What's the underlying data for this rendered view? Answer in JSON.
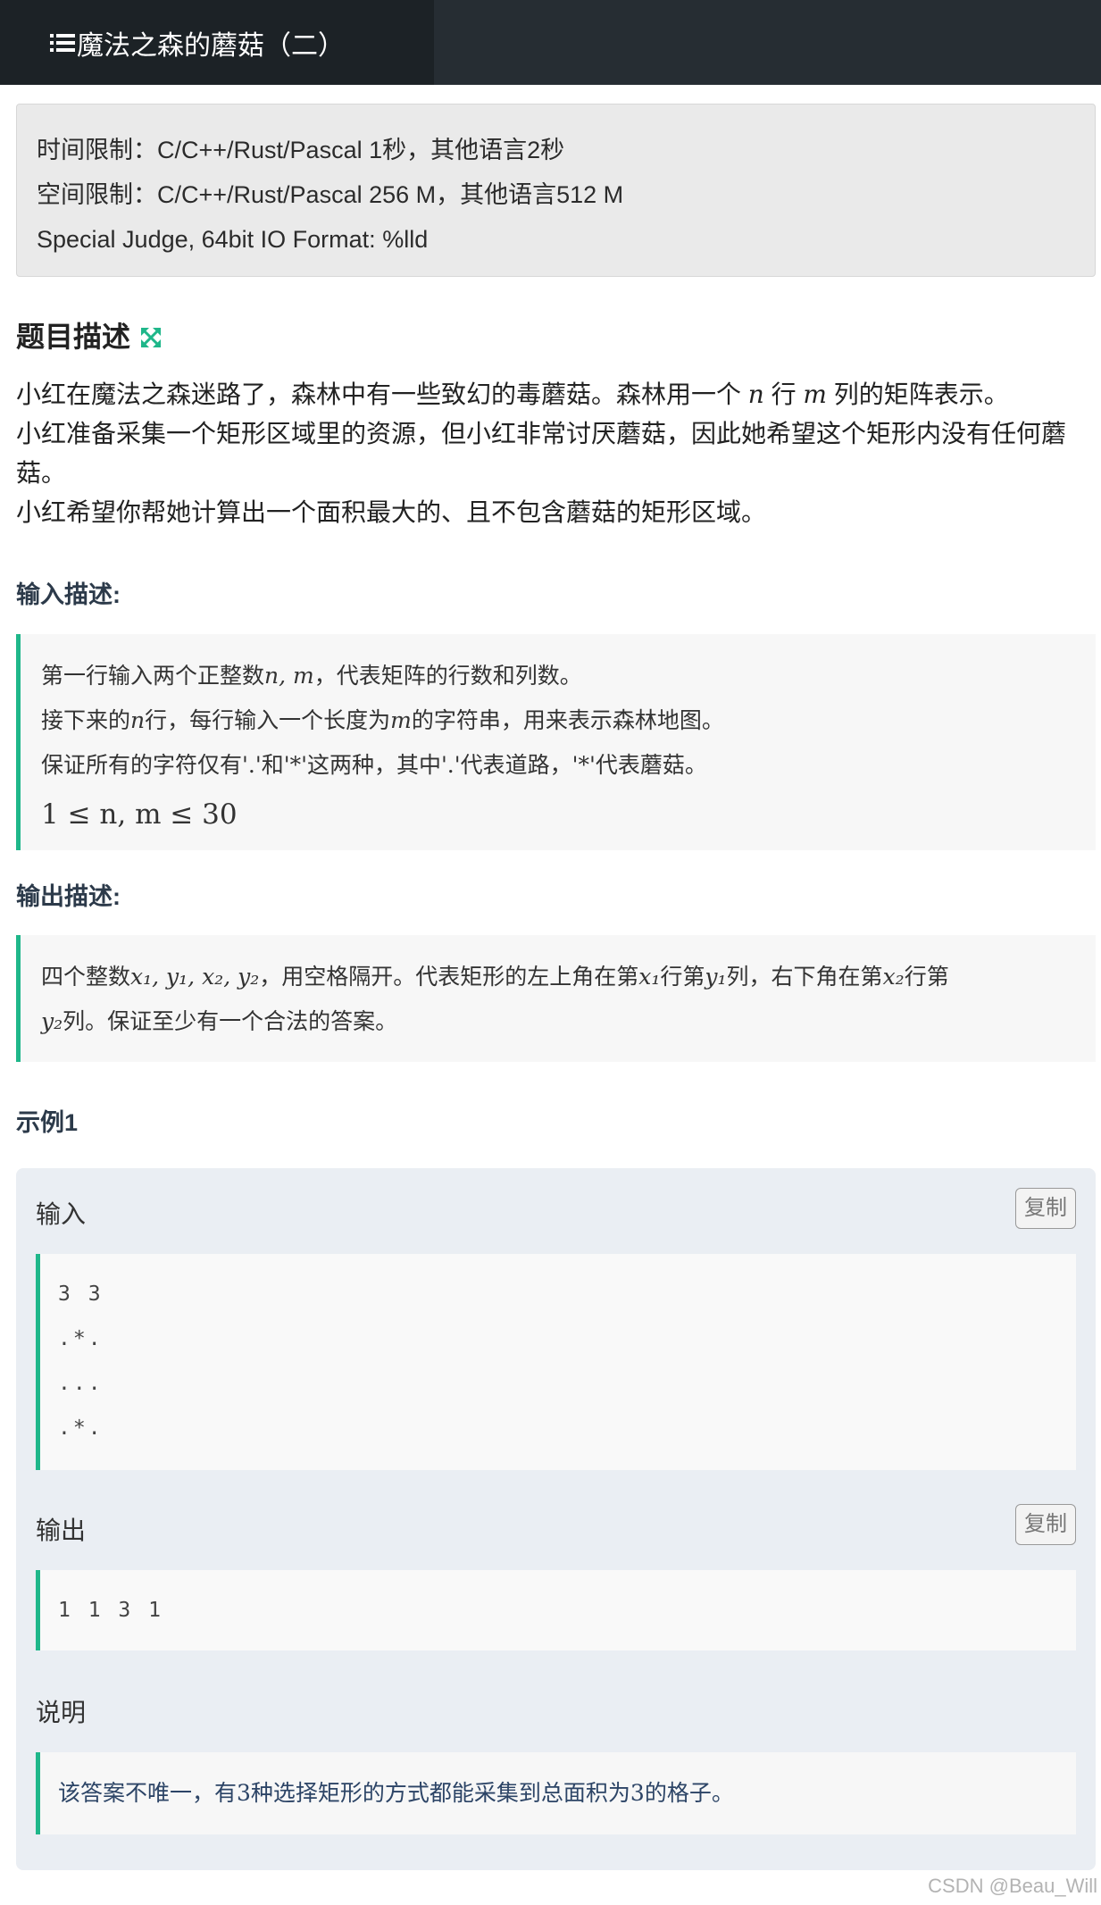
{
  "header": {
    "title": "魔法之森的蘑菇（二）",
    "icon": "list-icon"
  },
  "limits": {
    "time": "时间限制：C/C++/Rust/Pascal 1秒，其他语言2秒",
    "memory": "空间限制：C/C++/Rust/Pascal 256 M，其他语言512 M",
    "judge": "Special Judge, 64bit IO Format: %lld"
  },
  "description": {
    "title": "题目描述",
    "expand_icon": "expand-icon",
    "p1_a": "小红在魔法之森迷路了，森林中有一些致幻的毒蘑菇。森林用一个 ",
    "p1_n": "n",
    "p1_b": " 行 ",
    "p1_m": "m",
    "p1_c": " 列的矩阵表示。",
    "p2": "小红准备采集一个矩形区域里的资源，但小红非常讨厌蘑菇，因此她希望这个矩形内没有任何蘑菇。",
    "p3": "小红希望你帮她计算出一个面积最大的、且不包含蘑菇的矩形区域。"
  },
  "input_desc": {
    "title": "输入描述:",
    "line1_a": "第一行输入两个正整数",
    "line1_math": "n, m",
    "line1_b": "，代表矩阵的行数和列数。",
    "line2_a": "接下来的",
    "line2_n": "n",
    "line2_b": "行，每行输入一个长度为",
    "line2_m": "m",
    "line2_c": "的字符串，用来表示森林地图。",
    "line3": "保证所有的字符仅有'.'和'*'这两种，其中'.'代表道路，'*'代表蘑菇。",
    "line4": "1 ≤ n, m ≤ 30"
  },
  "output_desc": {
    "title": "输出描述:",
    "a": "四个整数",
    "vars": "x₁, y₁, x₂, y₂",
    "b": "，用空格隔开。代表矩形的左上角在第",
    "x1": "x₁",
    "c": "行第",
    "y1": "y₁",
    "d": "列，右下角在第",
    "x2": "x₂",
    "e": "行第",
    "y2": "y₂",
    "f": "列。保证至少有一个合法的答案。"
  },
  "example": {
    "title": "示例1",
    "input_label": "输入",
    "output_label": "输出",
    "copy_label": "复制",
    "input_lines": [
      "3 3",
      ".*.",
      "...",
      ".*."
    ],
    "output_line": "1 1 3 1",
    "explain_label": "说明",
    "explain_text": "该答案不唯一，有3种选择矩形的方式都能采集到总面积为3的格子。"
  },
  "watermark": "CSDN @Beau_Will",
  "colors": {
    "accent": "#1fb78a",
    "topbar": "#262d33",
    "tab_active": "#1c2226"
  }
}
